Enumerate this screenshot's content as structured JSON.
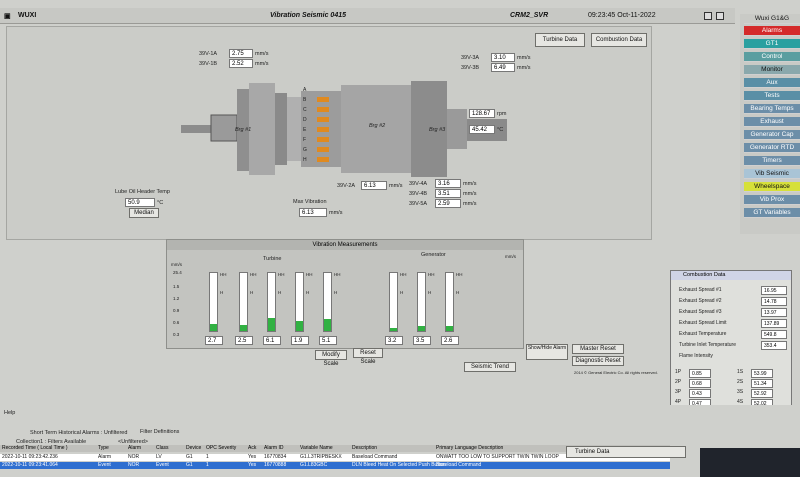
{
  "titlebar": {
    "app": "WUXI",
    "title": "Vibration Seismic 0415",
    "server": "CRM2_SVR",
    "datetime": "09:23:45 Oct-11-2022"
  },
  "toolbar": {
    "turbine_data": "Turbine Data",
    "combustion_data": "Combustion Data"
  },
  "sensors": [
    {
      "label": "39V-1A",
      "value": "2.75",
      "unit": "mm/s"
    },
    {
      "label": "39V-1B",
      "value": "2.52",
      "unit": "mm/s"
    },
    {
      "label": "39V-3A",
      "value": "3.10",
      "unit": "mm/s"
    },
    {
      "label": "39V-3B",
      "value": "6.49",
      "unit": "mm/s"
    },
    {
      "label": "39V-2A",
      "value": "6.13",
      "unit": "mm/s"
    },
    {
      "label": "39V-4A",
      "value": "3.16",
      "unit": "mm/s"
    },
    {
      "label": "39V-4B",
      "value": "3.51",
      "unit": "mm/s"
    },
    {
      "label": "39V-5A",
      "value": "2.59",
      "unit": "mm/s"
    }
  ],
  "bearings": {
    "brg1": "Brg #1",
    "brg2": "Brg #2",
    "brg3": "Brg #3"
  },
  "shaft": {
    "speed": "128.67",
    "speed_unit": "rpm",
    "temp": "45.42",
    "temp_unit": "°C"
  },
  "stage_letters": [
    "A",
    "B",
    "C",
    "D",
    "E",
    "F",
    "G",
    "H"
  ],
  "lube": {
    "title": "Lube Oil Header Temp",
    "value": "50.9",
    "unit": "°C",
    "median_label": "Median"
  },
  "max_vibration": {
    "label": "Max Vibration",
    "value": "6.13",
    "unit": "mm/s"
  },
  "vib_panel": {
    "title": "Vibration Measurements",
    "turbine_label": "Turbine",
    "generator_label": "Generator",
    "unit_left": "mm/s",
    "unit_right": "mm/s",
    "scale": [
      "25.4",
      "1.5",
      "1.2",
      "0.9",
      "0.6",
      "0.3",
      "0.0"
    ],
    "hh": "HH",
    "h": "H",
    "modify_scale": "Modify Scale",
    "reset_scale": "Reset Scale"
  },
  "vib_bars": [
    {
      "value": "2.7",
      "fill": 0.12
    },
    {
      "value": "2.5",
      "fill": 0.11
    },
    {
      "value": "6.1",
      "fill": 0.22
    },
    {
      "value": "1.9",
      "fill": 0.17
    },
    {
      "value": "5.1",
      "fill": 0.21
    },
    {
      "value": "3.2",
      "fill": 0.06
    },
    {
      "value": "3.5",
      "fill": 0.08
    },
    {
      "value": "2.6",
      "fill": 0.09
    }
  ],
  "buttons": {
    "show_hide_alarm": "Show/Hide Alarm",
    "master_reset": "Master Reset",
    "diagnostic_reset": "Diagnostic Reset",
    "seismic_trend": "Seismic Trend",
    "copyright": "2014 © General Electric Co. All rights reserved."
  },
  "sidebar": {
    "header": "Wuxi G1&G",
    "items": [
      {
        "label": "Alarms",
        "bg": "#d42a2a",
        "fg": "#ffffff"
      },
      {
        "label": "GT1",
        "bg": "#2aa0a0",
        "fg": "#ffffff"
      },
      {
        "label": "Control",
        "bg": "#5a9ea0",
        "fg": "#ffffff"
      },
      {
        "label": "Monitor",
        "bg": "#8aa8ac",
        "fg": "#111111"
      },
      {
        "label": "Aux",
        "bg": "#5a8fa6",
        "fg": "#ffffff"
      },
      {
        "label": "Tests",
        "bg": "#5a8fa6",
        "fg": "#ffffff"
      },
      {
        "label": "Bearing Temps",
        "bg": "#6c8ea8",
        "fg": "#ffffff"
      },
      {
        "label": "Exhaust",
        "bg": "#6c8ea8",
        "fg": "#ffffff"
      },
      {
        "label": "Generator Cap",
        "bg": "#6c8ea8",
        "fg": "#ffffff"
      },
      {
        "label": "Generator RTD",
        "bg": "#6c8ea8",
        "fg": "#ffffff"
      },
      {
        "label": "Timers",
        "bg": "#6c8ea8",
        "fg": "#ffffff"
      },
      {
        "label": "Vib Seismic",
        "bg": "#a9c4d6",
        "fg": "#111111"
      },
      {
        "label": "Wheelspace",
        "bg": "#d6e03a",
        "fg": "#111111"
      },
      {
        "label": "Vib Prox",
        "bg": "#6c8ea8",
        "fg": "#ffffff"
      },
      {
        "label": "GT Variables",
        "bg": "#6c8ea8",
        "fg": "#ffffff"
      }
    ]
  },
  "combustion": {
    "title": "Combustion Data",
    "rows": [
      {
        "label": "Exhaust Spread #1",
        "value": "16.95"
      },
      {
        "label": "Exhaust Spread #2",
        "value": "14.78"
      },
      {
        "label": "Exhaust Spread #3",
        "value": "13.97"
      },
      {
        "label": "Exhaust Spread Limit",
        "value": "137.89"
      },
      {
        "label": "Exhaust Temperature",
        "value": "549.8"
      },
      {
        "label": "Turbine Inlet Temperature",
        "value": "353.4"
      },
      {
        "label": "Flame Intensity",
        "value": ""
      }
    ],
    "flame": [
      {
        "a": "1P",
        "av": "0.85",
        "b": "1S",
        "bv": "53.99"
      },
      {
        "a": "2P",
        "av": "0.68",
        "b": "2S",
        "bv": "51.34"
      },
      {
        "a": "3P",
        "av": "0.43",
        "b": "3S",
        "bv": "52.92"
      },
      {
        "a": "4P",
        "av": "0.47",
        "b": "4S",
        "bv": "52.02"
      }
    ]
  },
  "alarm_panel": {
    "help": "Help",
    "tab1": "Short Term Historical Alarms : Unfiltered",
    "tab2": "Filter Definitions",
    "collection": "Collection1 : Filters Available",
    "filter": "<Unfiltered>",
    "columns": [
      "Recorded Time ( Local Time )",
      "Type",
      "Alarm",
      "Class",
      "Device",
      "OPC Severity",
      "Ack",
      "Alarm ID",
      "Variable Name",
      "Description",
      "Primary Language Description"
    ],
    "rows": [
      [
        "2022-10-11 09:23:42.236",
        "Alarm",
        "NOR",
        "LV",
        "G1",
        "1",
        "Yes",
        "16770834",
        "G1.L3TRIPBESKX",
        "Baseload Command",
        "ONWATT TOO LOW TO SUPPORT TWIN TWIN LOOP"
      ],
      [
        "2022-10-11 09:23:41.064",
        "Event",
        "NOR",
        "Event",
        "G1",
        "1",
        "Yes",
        "16770888",
        "G1.L83GBC",
        "DLN Bleed Heat On Selected Push Button",
        "Baseload Command"
      ]
    ]
  },
  "turbine_popup": {
    "title": "Turbine Data"
  }
}
